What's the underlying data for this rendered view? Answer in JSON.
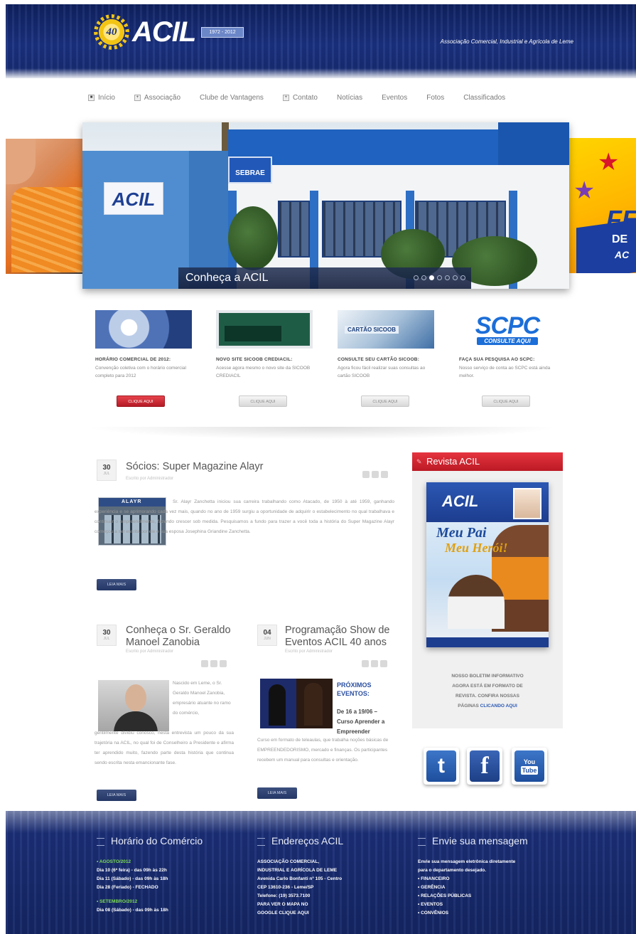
{
  "header": {
    "logo_badge": "40",
    "logo_text": "ACIL",
    "logo_years": "1972 - 2012",
    "tagline": "Associação Comercial, Industrial e Agrícola de Leme"
  },
  "nav": {
    "items": [
      "Início",
      "Associação",
      "Clube de Vantagens",
      "Contato",
      "Notícias",
      "Eventos",
      "Fotos",
      "Classificados"
    ]
  },
  "slider": {
    "caption": "Conheça a ACIL",
    "sign_acil": "ACIL",
    "sign_sebrae": "SEBRAE",
    "slide_count": 7,
    "active_slide": 3,
    "side_right_text_1": "FE",
    "side_right_text_2": "DE",
    "side_right_text_3": "AC"
  },
  "promos": [
    {
      "title": "HORÁRIO COMERCIAL DE 2012:",
      "text": "Convenção coletiva com o horário comercial completo para 2012",
      "button": "CLIQUE AQUI",
      "style": "red"
    },
    {
      "title": "NOVO SITE SICOOB CREDIACIL:",
      "text": "Acesse agora mesmo o novo site da SICOOB CREDIACIL",
      "button": "CLIQUE AQUI",
      "style": "gray"
    },
    {
      "title": "CONSULTE SEU CARTÃO SICOOB:",
      "text": "Agora ficou fácil realizar suas consultas ao cartão SICOOB",
      "button": "CLIQUE AQUI",
      "style": "gray",
      "image_label": "CARTÃO SICOOB"
    },
    {
      "title": "FAÇA SUA PESQUISA AO SCPC:",
      "text": "Nosso serviço de conta ao SCPC está ainda melhor.",
      "button": "CLIQUE AQUI",
      "style": "gray",
      "logo_big": "SCPC",
      "logo_small": "CONSULTE AQUI"
    }
  ],
  "articles": {
    "main": {
      "day": "30",
      "month": "JUL",
      "title": "Sócios: Super Magazine Alayr",
      "meta": "Escrito por Administrador",
      "image_label": "ALAYR",
      "body": "Sr. Alayr Zanchetta iniciou sua carreira trabalhando como Atacado, de 1950 à até 1959, ganhando experiência e se aprimorando cada vez mais, quando no ano de 1959 surgiu a oportunidade de adquirir o estabelecimento no qual trabalhava e continuar o empreendimento, fazendo crescer sob medida. Pesquisamos a fundo para trazer a você toda a história do Super Magazine Alayr começou a ser escrita por ele e sua esposa Josephina Griandine Zanchetta.",
      "button": "LEIA MAIS"
    },
    "second": {
      "day": "30",
      "month": "JUL",
      "title_line1": "Conheça o Sr. Geraldo",
      "title_line2": "Manoel Zanobia",
      "meta": "Escrito por Administrador",
      "body_right": "Nascido em Leme, o Sr. Geraldo Manoel Zanobia, empresário atuante no ramo do comércio,",
      "body_full": "gentilmente dividiu conosco, nesta entrevista um pouco da sua trajetória na ACIL, no qual foi de Conselheiro a Presidente e afirma ter aprendido muito, fazendo parte desta história que continua sendo escrita nesta emancionante fase.",
      "button": "LEIA MAIS"
    },
    "third": {
      "day": "04",
      "month": "JUN",
      "title_line1": "Programação Show de",
      "title_line2": "Eventos ACIL 40 anos",
      "meta": "Escrito por Administrador",
      "heading_line1": "PRÓXIMOS",
      "heading_line2": "EVENTOS:",
      "sub_line1": "De 16 a 19/06 –",
      "sub_line2": "Curso Aprender a",
      "sub_line3": "Empreender",
      "body": "Curso em formato de teleaulas, que trabalha noções básicas de EMPREENDEDORISMO, mercado e finanças. Os participantes recebem um manual para consultas e orientação.",
      "button": "LEIA MAIS"
    }
  },
  "sidebar": {
    "revista_title": "Revista ACIL",
    "mag_logo": "ACIL",
    "mag_title_1": "Meu Pai",
    "mag_title_2": "Meu Herói!",
    "text_line1": "NOSSO BOLETIM INFORMATIVO",
    "text_line2": "AGORA ESTÁ EM FORMATO DE",
    "text_line3": "REVISTA. CONFIRA NOSSAS",
    "text_line4": "PÁGINAS",
    "text_link": "CLICANDO AQUI",
    "social": {
      "twitter": "t",
      "facebook": "f",
      "youtube_top": "You",
      "youtube_bottom": "Tube"
    }
  },
  "footer": {
    "col1": {
      "title": "Horário do Comércio",
      "lines": [
        "• AGOSTO/2012",
        "Dia 10 (6ª feira) - das 09h às 22h",
        "Dia 11 (Sábado) - das 09h às 18h",
        "Dia 28 (Feriado) - FECHADO",
        "",
        "• SETEMBRO/2012",
        "Dia 08 (Sábado) - das 09h às 18h"
      ]
    },
    "col2": {
      "title": "Endereços ACIL",
      "lines": [
        "ASSOCIAÇÃO COMERCIAL,",
        "INDUSTRIAL E AGRÍCOLA DE LEME",
        "Avenida Carlo Bonfanti nº 105 - Centro",
        "CEP 13610-236 - Leme/SP",
        "Telefone: (19) 3573.7100",
        "PARA VER O MAPA NO",
        "GOOGLE CLIQUE AQUI"
      ]
    },
    "col3": {
      "title": "Envie sua mensagem",
      "lines": [
        "Envie sua mensagem eletrônica diretamente",
        "para o departamento desejado.",
        "• FINANCEIRO",
        "• GERÊNCIA",
        "• RELAÇÕES PÚBLICAS",
        "• EVENTOS",
        "• CONVÊNIOS"
      ]
    }
  }
}
